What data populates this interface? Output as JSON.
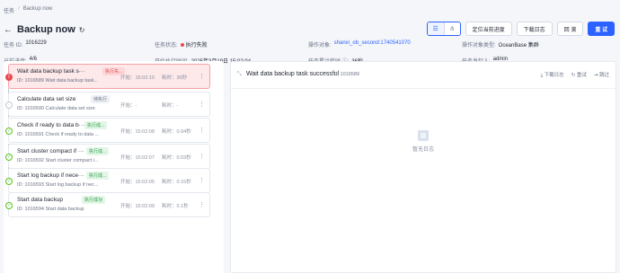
{
  "breadcrumb": {
    "root": "任务",
    "sep": "/",
    "current": "Backup now"
  },
  "header": {
    "title": "Backup now"
  },
  "toolbar": {
    "view_list": "☰",
    "view_tree": "⋔",
    "locate": "定位当前进度",
    "download_log": "下载日志",
    "rollback": "回 滚",
    "retry": "重 试"
  },
  "info": {
    "task_id_label": "任务 ID:",
    "task_id": "1016229",
    "status_label": "任务状态:",
    "status": "执行失败",
    "target_label": "操作对象:",
    "target": "shanxi_ob_second:1740541070",
    "target_type_label": "操作对象类型:",
    "target_type": "OceanBase 集群",
    "progress_label": "当前进度:",
    "progress": "4/6",
    "start_label": "开始执行时间:",
    "start_time": "2025年3月19日 15:02:04",
    "elapsed_label": "任务累计耗时 ⓘ:",
    "elapsed": "36秒",
    "initiator_label": "任务发起人:",
    "initiator": "admin"
  },
  "tasks": [
    {
      "name": "Wait data backup task s···",
      "badge": "执行失...",
      "sub": "ID: 1016589  Wait data backup task...",
      "start": "开始：15:02:10",
      "cost": "耗时：30秒"
    },
    {
      "name": "Calculate data set size",
      "badge": "待执行",
      "sub": "ID: 1016590  Calculate data set size",
      "start": "开始：-",
      "cost": "耗时：-"
    },
    {
      "name": "Check if ready to data b···",
      "badge": "执行成...",
      "sub": "ID: 1016591  Check if ready to data ...",
      "start": "开始：15:02:08",
      "cost": "耗时：0.04秒"
    },
    {
      "name": "Start cluster compact if ···",
      "badge": "执行成...",
      "sub": "ID: 1016592  Start cluster compact i...",
      "start": "开始：15:02:07",
      "cost": "耗时：0.03秒"
    },
    {
      "name": "Start log backup if nece···",
      "badge": "执行成...",
      "sub": "ID: 1016593  Start log backup if nec...",
      "start": "开始：15:02:05",
      "cost": "耗时：0.15秒"
    },
    {
      "name": "Start data backup",
      "badge": "执行成功",
      "sub": "ID: 1016594  Start data backup",
      "start": "开始：15:02:09",
      "cost": "耗时：0.1秒"
    }
  ],
  "detail": {
    "title": "Wait data backup task successful",
    "id": "ID: 1016589",
    "download_log": "下载日志",
    "retry": "重试",
    "skip": "跳过",
    "empty": "暂无日志"
  },
  "colors": {
    "accent": "#2c62ff",
    "fail": "#e5484d",
    "success": "#2e9e4a"
  }
}
